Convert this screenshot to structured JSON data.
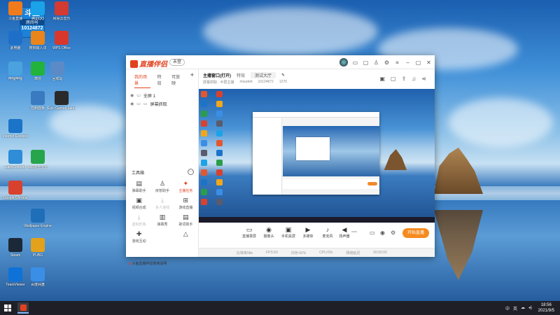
{
  "desktop": {
    "banner": {
      "line1": "斗鱼",
      "line2": "房间号",
      "line3": "10124872"
    },
    "icons": [
      {
        "label": "斗鱼直播",
        "color": "#f07b1c"
      },
      {
        "label": "腾讯QQ",
        "color": "#1aa3e8"
      },
      {
        "label": "此电脑",
        "color": "#1e6fc8"
      },
      {
        "label": "哔哩哔哩",
        "color": "#4aa3df"
      },
      {
        "label": "微信",
        "color": "#22b33c"
      },
      {
        "label": "回收站",
        "color": "#5a8bc7"
      },
      {
        "label": "控制面板",
        "color": "#3a7ac0"
      },
      {
        "label": "Epic Games Launcher",
        "color": "#2a2a2a"
      },
      {
        "label": "Internet Explorer",
        "color": "#1b74c8"
      },
      {
        "label": "EasyConnect",
        "color": "#2e8dd6"
      },
      {
        "label": "360安全卫士",
        "color": "#27a54a"
      },
      {
        "label": "Google Chrome",
        "color": "#d9412f"
      },
      {
        "label": "Steam",
        "color": "#1b2838"
      },
      {
        "label": "Wallpaper Engine",
        "color": "#1f6fb8"
      },
      {
        "label": "PUBG",
        "color": "#e3a11c"
      },
      {
        "label": "TeamViewer",
        "color": "#0e72d8"
      },
      {
        "label": "百度网盘",
        "color": "#3a8ee6"
      },
      {
        "label": "网易云音乐",
        "color": "#d33a31"
      },
      {
        "label": "WPS Office",
        "color": "#d8372c"
      },
      {
        "label": "搜狗输入法",
        "color": "#e9851b"
      }
    ]
  },
  "app": {
    "logo": "直播伴侣",
    "login_chip": "未登",
    "left_tabs": [
      "我的场景",
      "特效",
      "可放映"
    ],
    "scene": {
      "label": "全屏 1",
      "sub": "屏幕抓取"
    },
    "tools_heading": "工具箱",
    "tools": [
      {
        "label": "弹幕助手",
        "icon": "▤"
      },
      {
        "label": "房管助手",
        "icon": "♙"
      },
      {
        "label": "主播任务",
        "icon": "✦",
        "state": "hot"
      },
      {
        "label": "视频合成",
        "icon": "▣"
      },
      {
        "label": "多人连线",
        "icon": "⤓",
        "state": "dim"
      },
      {
        "label": "游戏直播",
        "icon": "⊞"
      },
      {
        "label": "虚拟形象",
        "icon": "⤓",
        "state": "dim"
      },
      {
        "label": "弹幕秀",
        "icon": "▥"
      },
      {
        "label": "歌词助手",
        "icon": "▤"
      },
      {
        "label": "游戏互动",
        "icon": "✚"
      },
      {
        "label": "",
        "icon": ""
      },
      {
        "label": "",
        "icon": "△"
      }
    ],
    "notice": "斗鱼直播伴侣使用说明",
    "room": {
      "title": "主播窗口(打开)",
      "tab2": "特效",
      "name": "测试大厅",
      "sub1": "屏幕抓取 · 半屏主播",
      "sub2": "moudeb",
      "room_id": "10124872",
      "count": "1276"
    },
    "controls": [
      {
        "label": "直播录屏",
        "icon": "▭"
      },
      {
        "label": "摄像头",
        "icon": "◉"
      },
      {
        "label": "手机投屏",
        "icon": "▣"
      },
      {
        "label": "多媒体",
        "icon": "▶"
      },
      {
        "label": "麦克风",
        "icon": "♪"
      },
      {
        "label": "扬声器",
        "icon": "◀"
      }
    ],
    "start_button": "开始直播",
    "status": [
      "比特率0kb",
      "FPS:60",
      "内存:42%",
      "CPU:6%",
      "网络延迟",
      "00:00:00"
    ]
  },
  "taskbar": {
    "tray": [
      "中",
      "英",
      "☁",
      "◂)"
    ],
    "time": "18:56",
    "date": "2021/9/5"
  }
}
